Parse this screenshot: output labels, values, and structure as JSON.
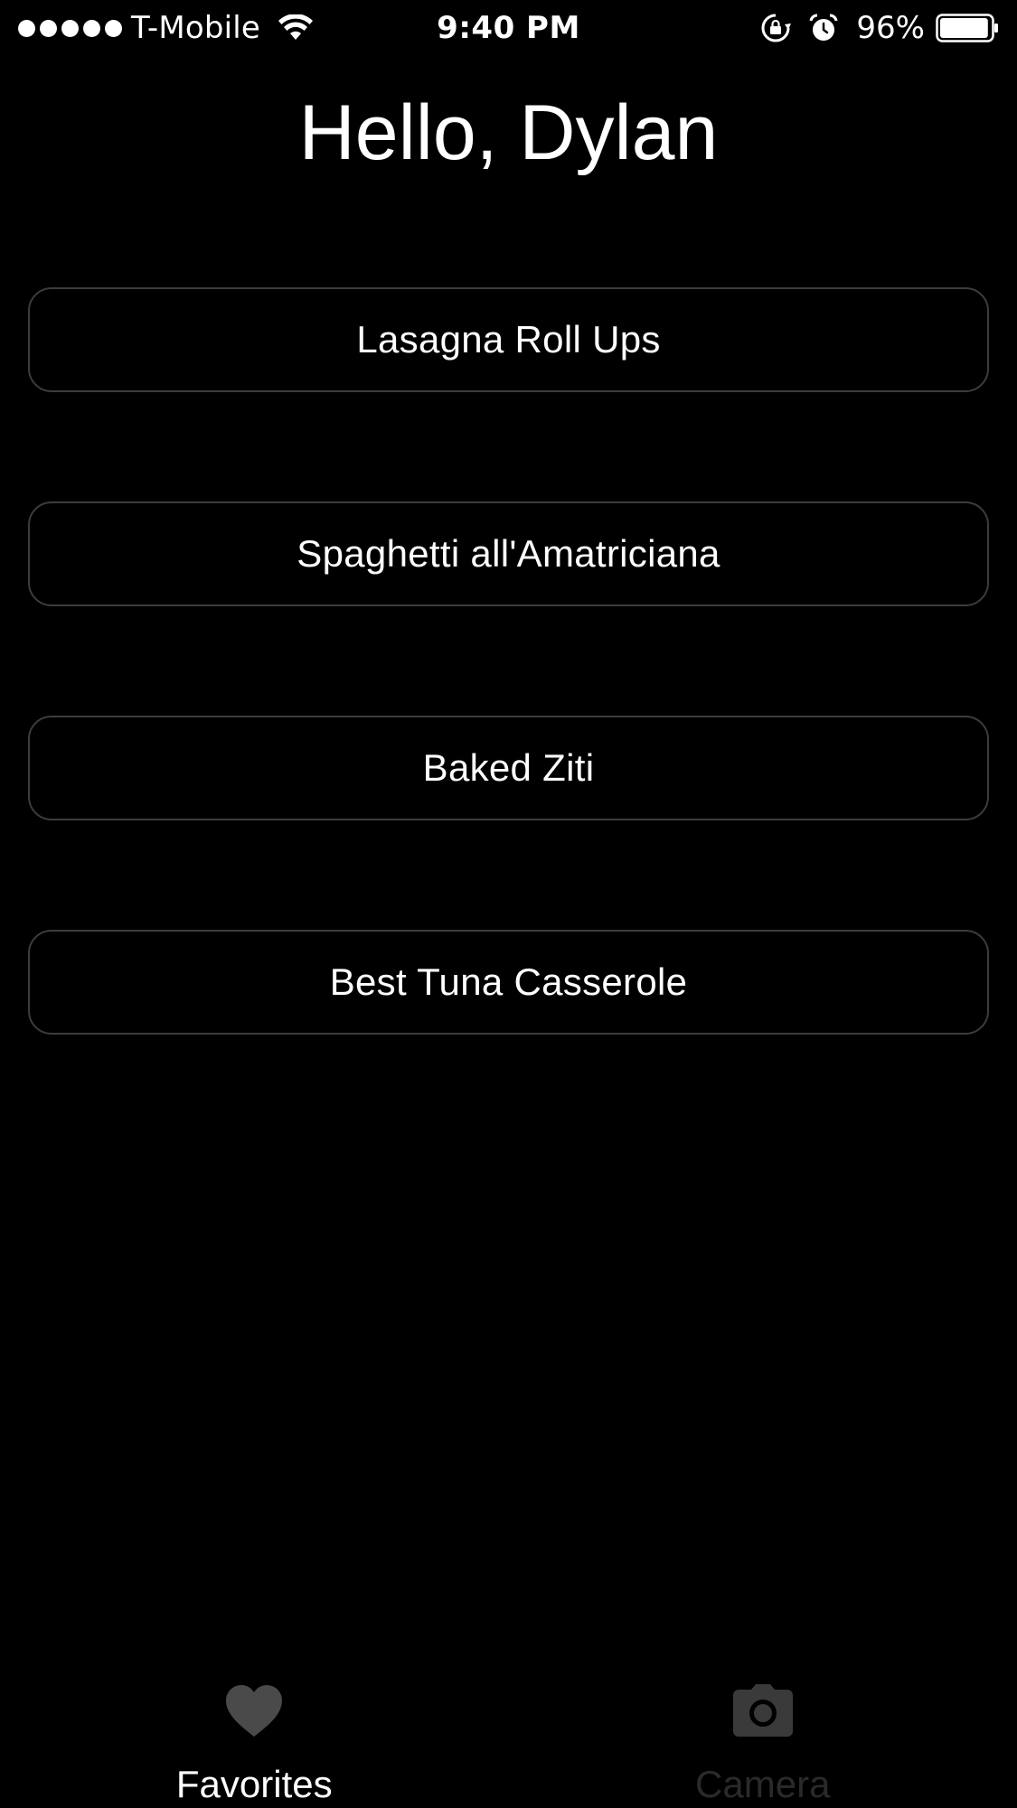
{
  "status_bar": {
    "carrier": "T-Mobile",
    "time": "9:40 PM",
    "battery_percent": "96%",
    "signal_bars": 5,
    "battery_level": 0.96,
    "icons": [
      "wifi-icon",
      "rotation-lock-icon",
      "alarm-icon",
      "battery-icon"
    ]
  },
  "greeting": "Hello, Dylan",
  "recipes": [
    "Lasagna Roll Ups",
    "Spaghetti all'Amatriciana",
    "Baked Ziti",
    "Best Tuna Casserole"
  ],
  "tab_bar": {
    "tabs": [
      {
        "label": "Favorites",
        "icon": "heart-icon",
        "active": true
      },
      {
        "label": "Camera",
        "icon": "camera-icon",
        "active": false
      }
    ]
  },
  "colors": {
    "background": "#000000",
    "text": "#ffffff",
    "button_border": "#3c3c3c",
    "active_tab_icon": "#4a4a4a",
    "inactive_tab": "#2a2a2a"
  }
}
